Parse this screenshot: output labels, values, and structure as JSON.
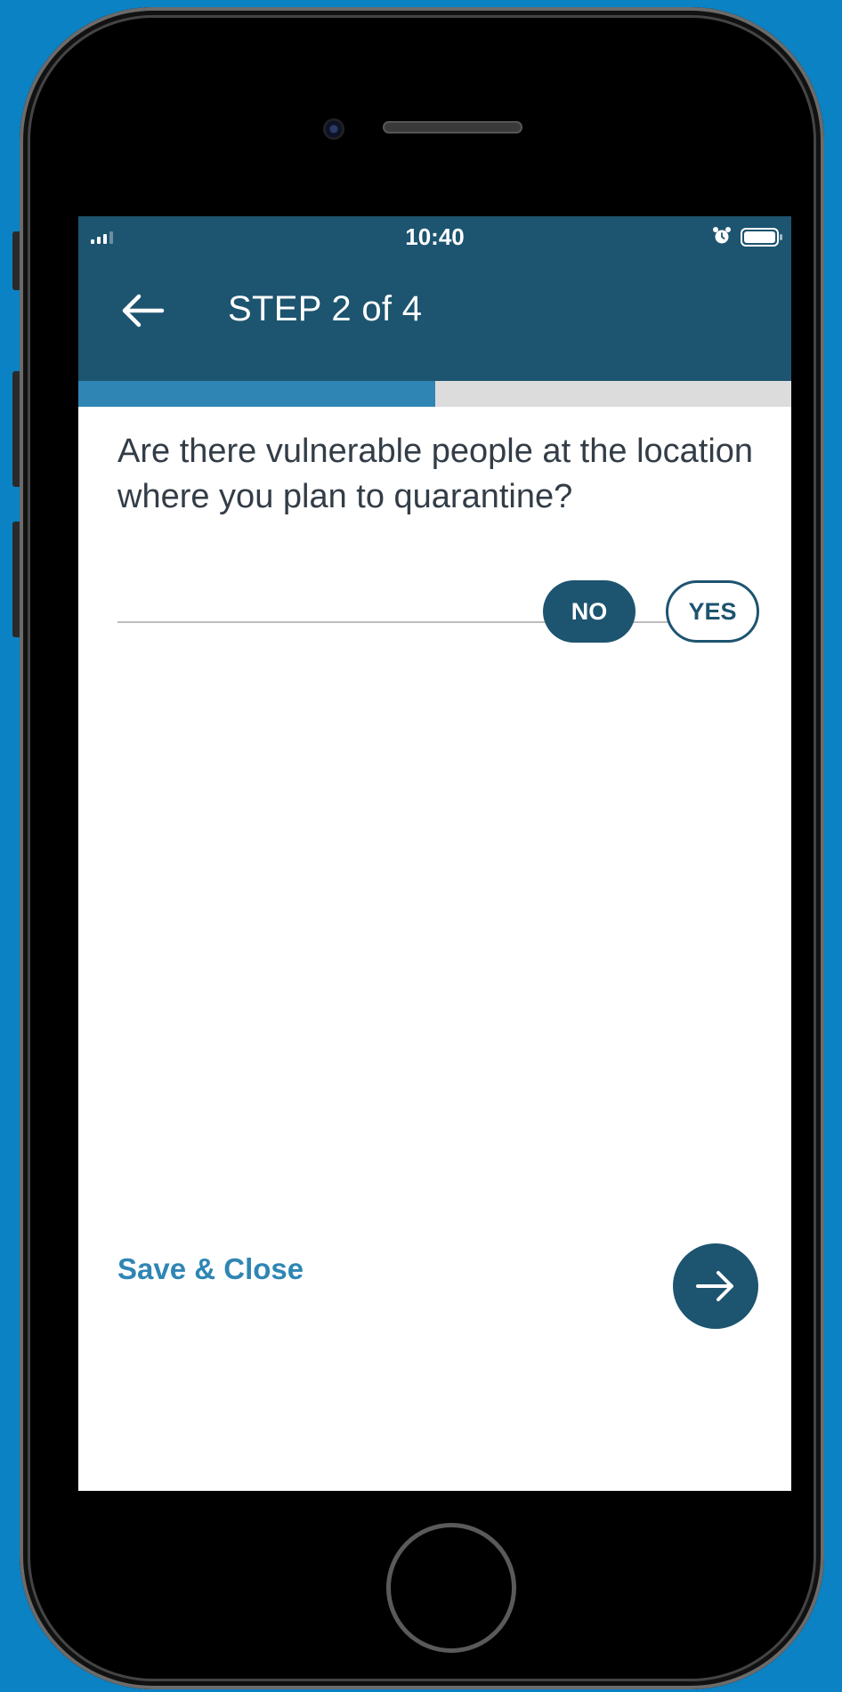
{
  "status_bar": {
    "time": "10:40",
    "icons": [
      "signal-icon",
      "alarm-icon",
      "battery-icon"
    ]
  },
  "header": {
    "back_icon": "arrow-left-icon",
    "title": "STEP 2 of 4"
  },
  "progress": {
    "current_step": 2,
    "total_steps": 4,
    "fraction": 0.5
  },
  "question": {
    "text": "Are there vulnerable people at the location where you plan to quarantine?"
  },
  "answers": {
    "no_label": "NO",
    "yes_label": "YES",
    "selected": "NO"
  },
  "footer": {
    "save_close_label": "Save & Close",
    "next_icon": "arrow-right-icon"
  },
  "colors": {
    "header_bg": "#1d5470",
    "accent": "#2f86b4",
    "progress_track": "#dcdcdc",
    "background": "#0a82c4"
  }
}
